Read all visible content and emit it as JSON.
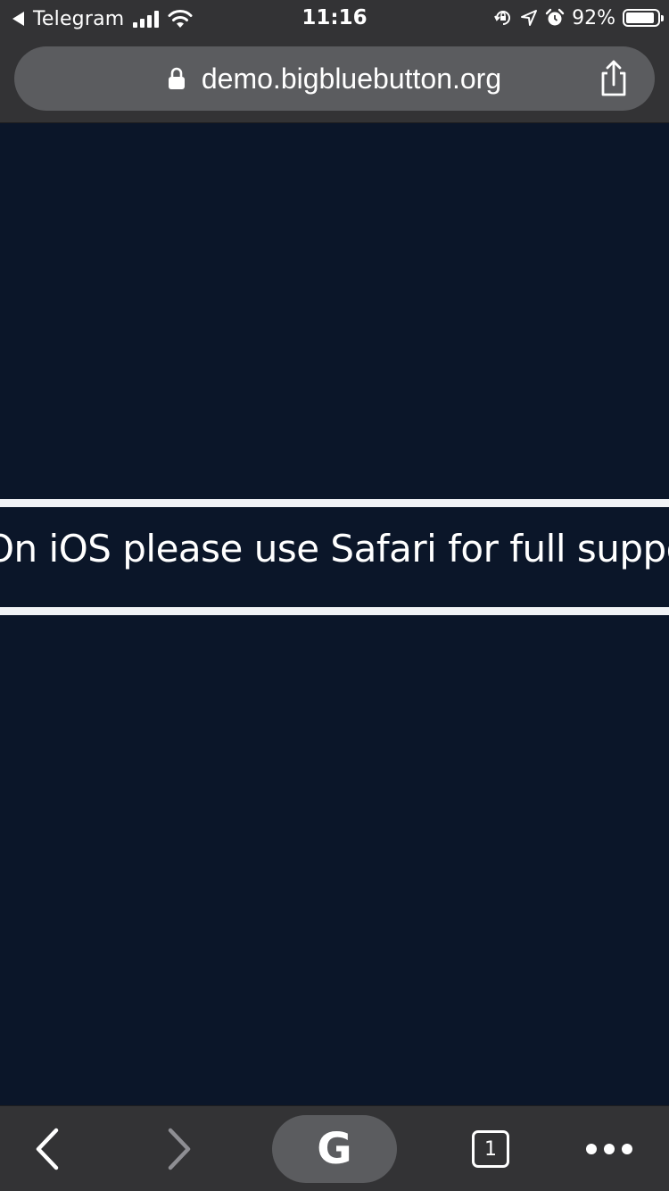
{
  "status_bar": {
    "back_app": "Telegram",
    "time": "11:16",
    "battery_percent": "92%",
    "battery_level": 0.92,
    "icons": [
      "signal-icon",
      "wifi-icon",
      "rotation-lock-icon",
      "location-icon",
      "alarm-icon",
      "battery-icon"
    ]
  },
  "url_bar": {
    "url": "demo.bigbluebutton.org",
    "icons": [
      "lock-icon",
      "share-icon"
    ]
  },
  "content": {
    "notice": "On iOS please use Safari for full support"
  },
  "toolbar": {
    "google_label": "G",
    "tab_count": "1",
    "icons": [
      "back-icon",
      "forward-icon",
      "google-icon",
      "tabs-icon",
      "more-icon"
    ]
  },
  "colors": {
    "chrome": "#333335",
    "url_pill": "#5b5c5f",
    "page_bg": "#0b1629",
    "band_border": "#f1f3f6",
    "text": "#ffffff",
    "forward_disabled": "#8e8e93"
  }
}
